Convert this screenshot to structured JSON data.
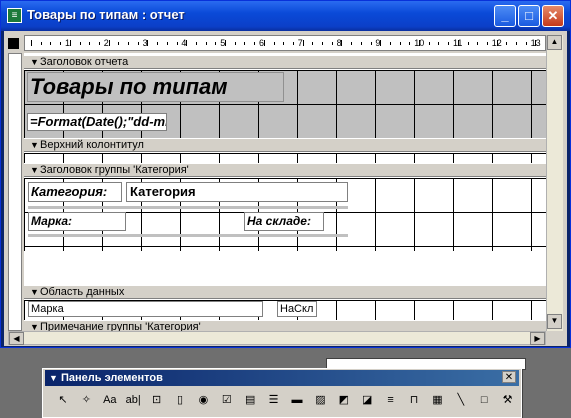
{
  "window": {
    "title": "Товары по типам : отчет",
    "min": "_",
    "max": "□",
    "close": "✕",
    "app_icon": "access-report-icon"
  },
  "ruler": {
    "numbers": [
      "1",
      "2",
      "3",
      "4",
      "5",
      "6",
      "7",
      "8",
      "9",
      "10",
      "11",
      "12",
      "13"
    ]
  },
  "bands": {
    "report_header": "Заголовок отчета",
    "page_header": "Верхний колонтитул",
    "group_header": "Заголовок группы 'Категория'",
    "detail": "Область данных",
    "group_footer": "Примечание группы 'Категория'"
  },
  "controls": {
    "title": "Товары по типам",
    "date_expr": "=Format(Date();\"dd-mi",
    "category_label": "Категория:",
    "category_field": "Категория",
    "brand_label": "Марка:",
    "stock_label": "На складе:",
    "brand_field": "Марка",
    "stock_field": "НаСкл"
  },
  "toolbox": {
    "title": "Панель элементов",
    "close": "✕",
    "tools": [
      {
        "name": "select-objects-tool",
        "glyph": "↖"
      },
      {
        "name": "control-wizards-tool",
        "glyph": "✧"
      },
      {
        "name": "label-tool",
        "glyph": "Aa"
      },
      {
        "name": "textbox-tool",
        "glyph": "ab|"
      },
      {
        "name": "option-group-tool",
        "glyph": "⊡"
      },
      {
        "name": "toggle-button-tool",
        "glyph": "▯"
      },
      {
        "name": "option-button-tool",
        "glyph": "◉"
      },
      {
        "name": "checkbox-tool",
        "glyph": "☑"
      },
      {
        "name": "combo-box-tool",
        "glyph": "▤"
      },
      {
        "name": "list-box-tool",
        "glyph": "☰"
      },
      {
        "name": "command-button-tool",
        "glyph": "▬"
      },
      {
        "name": "image-tool",
        "glyph": "▨"
      },
      {
        "name": "unbound-object-tool",
        "glyph": "◩"
      },
      {
        "name": "bound-object-tool",
        "glyph": "◪"
      },
      {
        "name": "page-break-tool",
        "glyph": "≡"
      },
      {
        "name": "tab-control-tool",
        "glyph": "⊓"
      },
      {
        "name": "subform-tool",
        "glyph": "▦"
      },
      {
        "name": "line-tool",
        "glyph": "╲"
      },
      {
        "name": "rectangle-tool",
        "glyph": "□"
      },
      {
        "name": "more-controls-tool",
        "glyph": "⚒"
      }
    ]
  },
  "colors": {
    "title_bar": "#0a4ad8",
    "band_selected": "#c0c0c0",
    "face": "#d4d0c8"
  }
}
